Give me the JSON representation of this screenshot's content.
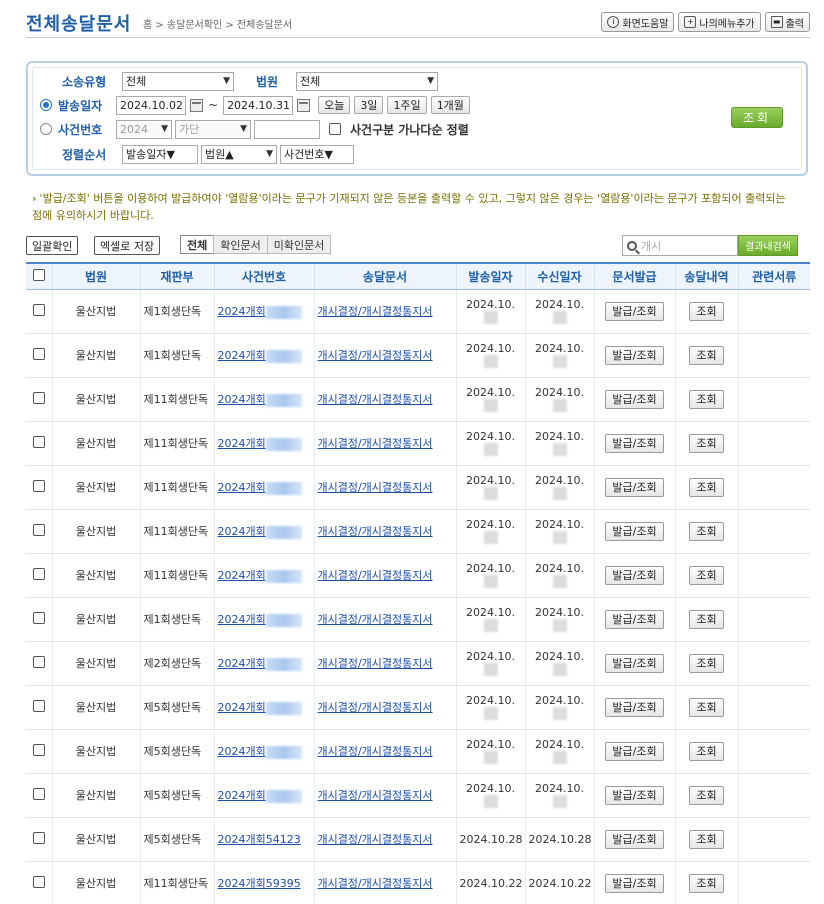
{
  "header": {
    "title": "전체송달문서",
    "breadcrumb": "홈 > 송달문서확인 > 전체송달문서",
    "buttons": [
      {
        "label": "화면도움말",
        "icon": "info-icon"
      },
      {
        "label": "나의메뉴추가",
        "icon": "bookmark-add-icon"
      },
      {
        "label": "출력",
        "icon": "printer-icon"
      }
    ]
  },
  "search": {
    "litigation_type_label": "소송유형",
    "litigation_type_value": "전체",
    "court_label": "법원",
    "court_value": "전체",
    "send_date_label": "발송일자",
    "date_from": "2024.10.02",
    "date_sep": "~",
    "date_to": "2024.10.31",
    "quick_ranges": [
      "오늘",
      "3일",
      "1주일",
      "1개월"
    ],
    "case_no_label": "사건번호",
    "case_year": "2024",
    "case_type": "가단",
    "case_number": "",
    "case_sort_label": "사건구분 가나다순 정렬",
    "sort_label": "정렬순서",
    "sort_1": "발송일자▼",
    "sort_2": "법원▲",
    "sort_3": "사건번호▼",
    "query_button": "조회"
  },
  "notice": "'발급/조회' 버튼을 이용하여 발급하여야 '열람용'이라는 문구가 기재되지 않은 등본을 출력할 수 있고, 그렇지 않은 경우는 '열람용'이라는 문구가 포함되어 출력되는 점에 유의하시기 바랍니다.",
  "toolbar": {
    "bulk_confirm": "일괄확인",
    "excel_save": "엑셀로 저장",
    "tabs": [
      "전체",
      "확인문서",
      "미확인문서"
    ],
    "search_placeholder": "개시",
    "result_search": "결과내검색"
  },
  "table": {
    "columns": [
      "법원",
      "재판부",
      "사건번호",
      "송달문서",
      "발송일자",
      "수신일자",
      "문서발급",
      "송달내역",
      "관련서류"
    ],
    "issue_label": "발급/조회",
    "view_label": "조회",
    "rows": [
      {
        "court": "울산지법",
        "division": "제1회생단독",
        "case": "2024개회",
        "doc": "개시결정/개시결정통지서",
        "sent": "2024.10.",
        "recv": "2024.10."
      },
      {
        "court": "울산지법",
        "division": "제1회생단독",
        "case": "2024개회",
        "doc": "개시결정/개시결정통지서",
        "sent": "2024.10.",
        "recv": "2024.10."
      },
      {
        "court": "울산지법",
        "division": "제11회생단독",
        "case": "2024개회",
        "doc": "개시결정/개시결정통지서",
        "sent": "2024.10.",
        "recv": "2024.10."
      },
      {
        "court": "울산지법",
        "division": "제11회생단독",
        "case": "2024개회",
        "doc": "개시결정/개시결정통지서",
        "sent": "2024.10.",
        "recv": "2024.10."
      },
      {
        "court": "울산지법",
        "division": "제11회생단독",
        "case": "2024개회",
        "doc": "개시결정/개시결정통지서",
        "sent": "2024.10.",
        "recv": "2024.10."
      },
      {
        "court": "울산지법",
        "division": "제11회생단독",
        "case": "2024개회",
        "doc": "개시결정/개시결정통지서",
        "sent": "2024.10.",
        "recv": "2024.10."
      },
      {
        "court": "울산지법",
        "division": "제11회생단독",
        "case": "2024개회",
        "doc": "개시결정/개시결정통지서",
        "sent": "2024.10.",
        "recv": "2024.10."
      },
      {
        "court": "울산지법",
        "division": "제1회생단독",
        "case": "2024개회",
        "doc": "개시결정/개시결정통지서",
        "sent": "2024.10.",
        "recv": "2024.10."
      },
      {
        "court": "울산지법",
        "division": "제2회생단독",
        "case": "2024개회",
        "doc": "개시결정/개시결정통지서",
        "sent": "2024.10.",
        "recv": "2024.10."
      },
      {
        "court": "울산지법",
        "division": "제5회생단독",
        "case": "2024개회",
        "doc": "개시결정/개시결정통지서",
        "sent": "2024.10.",
        "recv": "2024.10."
      },
      {
        "court": "울산지법",
        "division": "제5회생단독",
        "case": "2024개회",
        "doc": "개시결정/개시결정통지서",
        "sent": "2024.10.",
        "recv": "2024.10."
      },
      {
        "court": "울산지법",
        "division": "제5회생단독",
        "case": "2024개회",
        "doc": "개시결정/개시결정통지서",
        "sent": "2024.10.",
        "recv": "2024.10."
      },
      {
        "court": "울산지법",
        "division": "제5회생단독",
        "case": "2024개회54123",
        "doc": "개시결정/개시결정통지서",
        "sent": "2024.10.28",
        "recv": "2024.10.28",
        "clear": true
      },
      {
        "court": "울산지법",
        "division": "제11회생단독",
        "case": "2024개회59395",
        "doc": "개시결정/개시결정통지서",
        "sent": "2024.10.22",
        "recv": "2024.10.22",
        "clear": true
      }
    ]
  }
}
